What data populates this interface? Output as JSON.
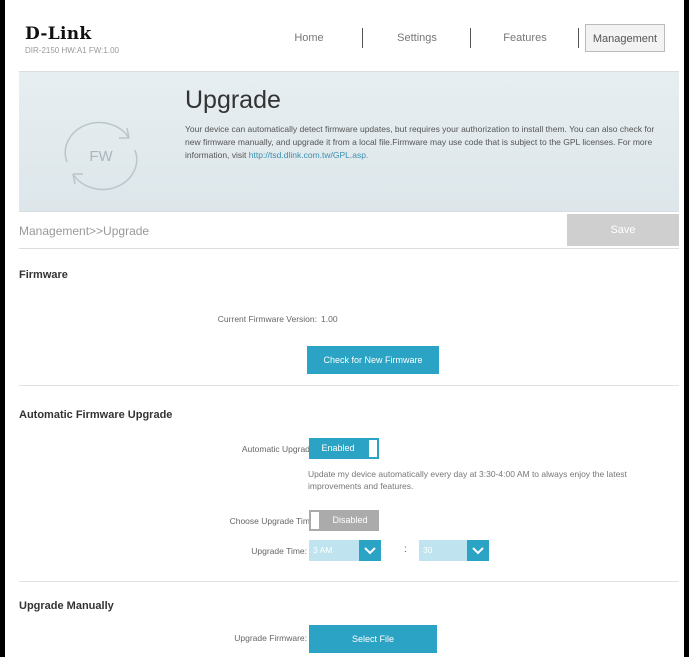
{
  "header": {
    "logo": "D-Link",
    "model": "DIR-2150 HW:A1 FW:1.00",
    "nav": [
      "Home",
      "Settings",
      "Features",
      "Management"
    ]
  },
  "hero": {
    "title": "Upgrade",
    "icon_label": "FW",
    "text": "Your device can automatically detect firmware updates, but requires your authorization to install them. You can also check for new firmware manually, and upgrade it from a local file.Firmware may use code that is subject to the GPL licenses. For more information, visit ",
    "link": "http://tsd.dlink.com.tw/GPL.asp."
  },
  "breadcrumb": "Management>>Upgrade",
  "save_label": "Save",
  "firmware": {
    "title": "Firmware",
    "current_label": "Current Firmware Version:",
    "current_value": "1.00",
    "check_button": "Check for New Firmware"
  },
  "auto_upgrade": {
    "title": "Automatic Firmware Upgrade",
    "auto_label": "Automatic Upgrade:",
    "auto_state": "Enabled",
    "note": "Update my device automatically every day at 3:30-4:00 AM to always enjoy the latest improvements and features.",
    "choose_label": "Choose Upgrade Time:",
    "choose_state": "Disabled",
    "time_label": "Upgrade Time:",
    "hour": "3 AM",
    "separator": ":",
    "minute": "30"
  },
  "manual": {
    "title": "Upgrade Manually",
    "label": "Upgrade Firmware:",
    "button": "Select File"
  },
  "colors": {
    "accent": "#2aa3c4",
    "disabled": "#ababab"
  }
}
